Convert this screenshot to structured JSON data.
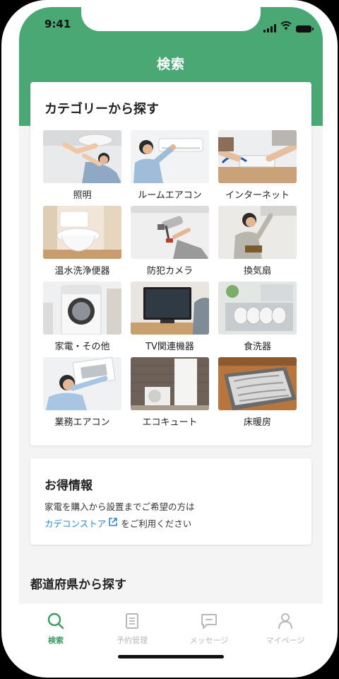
{
  "status_bar": {
    "time": "9:41"
  },
  "header": {
    "title": "検索"
  },
  "categories": {
    "heading": "カテゴリーから探す",
    "items": [
      {
        "label": "照明",
        "icon": "ceiling-light-photo"
      },
      {
        "label": "ルームエアコン",
        "icon": "air-conditioner-photo"
      },
      {
        "label": "インターネット",
        "icon": "internet-router-photo"
      },
      {
        "label": "温水洗浄便器",
        "icon": "toilet-photo"
      },
      {
        "label": "防犯カメラ",
        "icon": "security-camera-photo"
      },
      {
        "label": "換気扇",
        "icon": "ventilation-fan-photo"
      },
      {
        "label": "家電・その他",
        "icon": "washing-machine-photo"
      },
      {
        "label": "TV関連機器",
        "icon": "television-photo"
      },
      {
        "label": "食洗器",
        "icon": "dishwasher-photo"
      },
      {
        "label": "業務エアコン",
        "icon": "ceiling-aircon-photo"
      },
      {
        "label": "エコキュート",
        "icon": "water-heater-photo"
      },
      {
        "label": "床暖房",
        "icon": "floor-heating-photo"
      }
    ]
  },
  "deals": {
    "heading": "お得情報",
    "line1": "家電を購入から設置までご希望の方は",
    "link_text": "カデコンストア",
    "line2_suffix": "をご利用ください"
  },
  "prefecture": {
    "heading": "都道府県から探す"
  },
  "tabbar": {
    "items": [
      {
        "label": "検索",
        "icon": "search-icon",
        "active": true
      },
      {
        "label": "予約管理",
        "icon": "document-list-icon",
        "active": false
      },
      {
        "label": "メッセージ",
        "icon": "chat-bubble-icon",
        "active": false
      },
      {
        "label": "マイページ",
        "icon": "user-icon",
        "active": false
      }
    ]
  },
  "colors": {
    "brand": "#4aa874",
    "active_tab": "#3c9a66",
    "link": "#2a8bd4",
    "inactive_tab": "#b8b8b8"
  }
}
